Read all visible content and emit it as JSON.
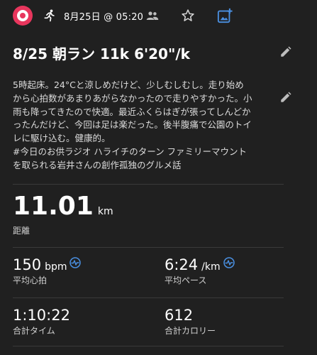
{
  "header": {
    "date": "8月25日 @ 05:20"
  },
  "activity": {
    "title": "8/25 朝ラン 11k 6'20\"/k",
    "description": "5時起床。24°Cと涼しめだけど、少しむしむし。走り始め\nから心拍数があまりあがらなかったので走りやすかった。小\n雨も降ってきたので快適。最近ふくらはぎが張ってしんどか\nったんだけど、今回は足は楽だった。後半腹痛で公園のトイ\nレに駆け込む。健康的。\n#今日のお供ラジオ ハライチのターン ファミリーマウント\nを取られる岩井さんの創作孤独のグルメ話"
  },
  "stats": {
    "distance": {
      "value": "11.01",
      "unit": "km",
      "label": "距離"
    },
    "heart_rate": {
      "value": "150",
      "unit": "bpm",
      "label": "平均心拍"
    },
    "pace": {
      "value": "6:24",
      "unit": "/km",
      "label": "平均ペース"
    },
    "time": {
      "value": "1:10:22",
      "label": "合計タイム"
    },
    "calories": {
      "value": "612",
      "label": "合計カロリー"
    }
  },
  "colors": {
    "background": "#202020",
    "accent_blue": "#4a90e2",
    "avatar_pink": "#e8365d",
    "divider": "#3a3a3a"
  },
  "icons": {
    "activity_type": "running-icon",
    "visibility": "people-icon",
    "favorite": "star-icon",
    "add_photo": "add-photo-icon",
    "edit": "pencil-icon",
    "heart_rate_badge": "pulse-icon"
  }
}
